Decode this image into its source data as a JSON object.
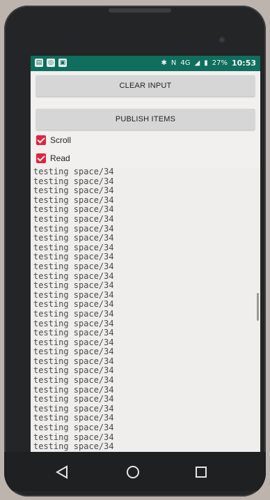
{
  "status_bar": {
    "network": "N",
    "signal": "4G",
    "battery": "27%",
    "time": "10:53"
  },
  "buttons": {
    "clear_input": "CLEAR INPUT",
    "publish_items": "PUBLISH ITEMS"
  },
  "checkboxes": {
    "scroll": {
      "label": "Scroll",
      "checked": true
    },
    "read": {
      "label": "Read",
      "checked": true
    }
  },
  "log": {
    "lines": [
      "testing space/34",
      "testing space/34",
      "testing space/34",
      "testing space/34",
      "testing space/34",
      "testing space/34",
      "testing space/34",
      "testing space/34",
      "testing space/34",
      "testing space/34",
      "testing space/34",
      "testing space/34",
      "testing space/34",
      "testing space/34",
      "testing space/34",
      "testing space/34",
      "testing space/34",
      "testing space/34",
      "testing space/34",
      "testing space/34",
      "testing space/34",
      "testing space/34",
      "testing space/34",
      "testing space/34",
      "testing space/34",
      "testing space/34",
      "testing space/34",
      "testing space/34",
      "testing space/34",
      "testing space/34"
    ]
  },
  "colors": {
    "status_bar": "#0f6e5d",
    "checkbox": "#e5213c"
  }
}
